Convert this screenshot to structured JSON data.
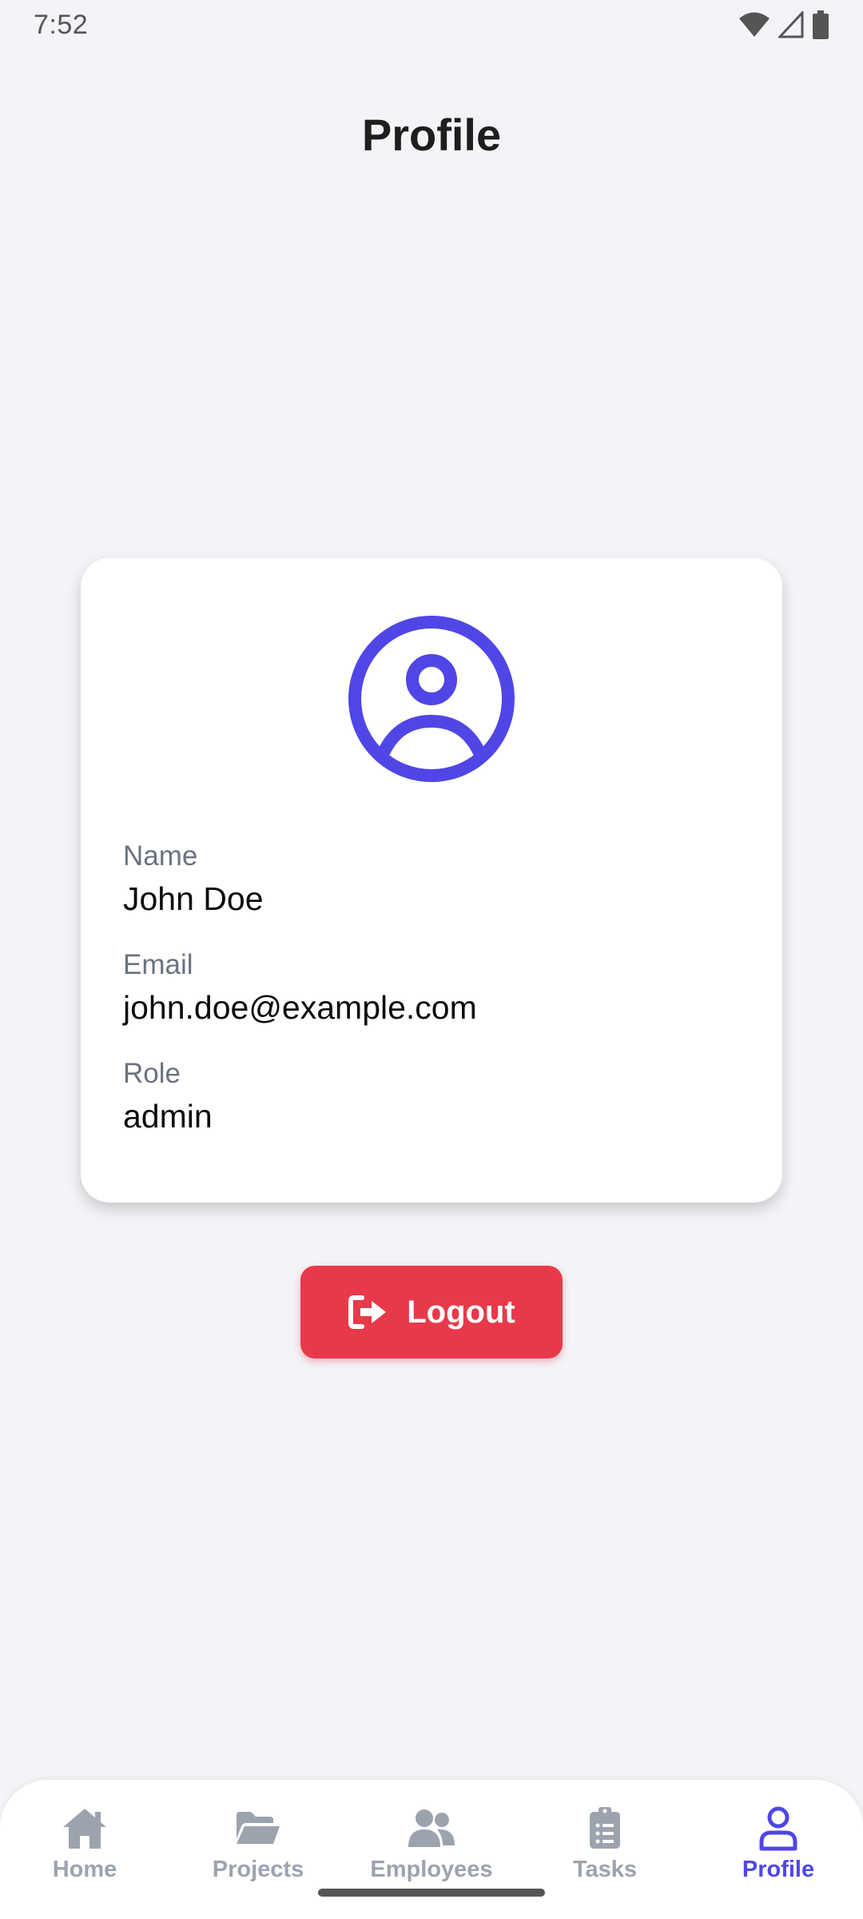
{
  "status_bar": {
    "time": "7:52",
    "icons": [
      "wifi-icon",
      "cellular-signal-icon",
      "battery-icon"
    ]
  },
  "page": {
    "title": "Profile"
  },
  "profile": {
    "avatar_icon": "user-circle-icon",
    "fields": {
      "name": {
        "label": "Name",
        "value": "John Doe"
      },
      "email": {
        "label": "Email",
        "value": "john.doe@example.com"
      },
      "role": {
        "label": "Role",
        "value": "admin"
      }
    }
  },
  "logout": {
    "label": "Logout",
    "icon": "sign-out-icon",
    "color": "#e8394a"
  },
  "bottom_nav": {
    "items": [
      {
        "label": "Home",
        "icon": "home-icon"
      },
      {
        "label": "Projects",
        "icon": "folder-open-icon"
      },
      {
        "label": "Employees",
        "icon": "users-icon"
      },
      {
        "label": "Tasks",
        "icon": "clipboard-list-icon"
      },
      {
        "label": "Profile",
        "icon": "user-icon",
        "active": true
      }
    ],
    "active_color": "#4f46e5",
    "inactive_color": "#9ca3af"
  }
}
